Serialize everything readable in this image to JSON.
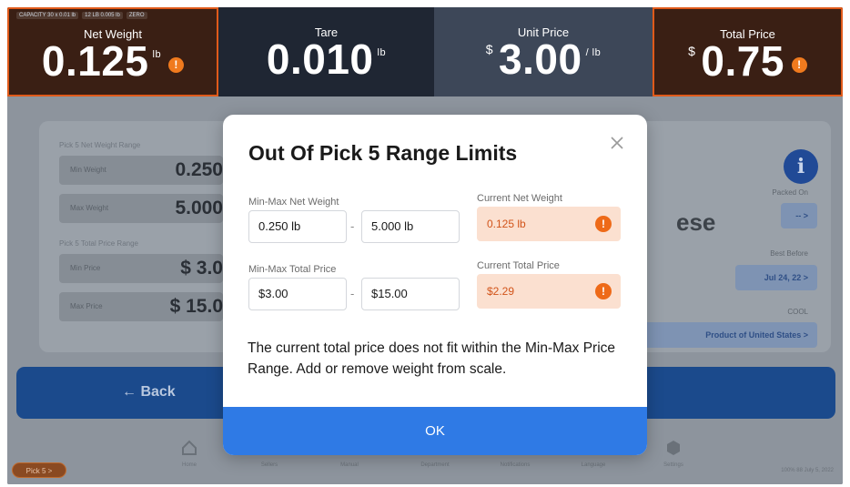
{
  "header": {
    "capacity_strip": [
      "CAPACITY 30 x 0.01 lb",
      "12 LB 0.005 lb",
      "ZERO"
    ],
    "net_weight": {
      "label": "Net Weight",
      "value": "0.125",
      "unit": "lb",
      "warning": "!"
    },
    "tare": {
      "label": "Tare",
      "value": "0.010",
      "unit": "lb"
    },
    "unit_price": {
      "label": "Unit Price",
      "currency": "$",
      "value": "3.00",
      "unit": "/ lb"
    },
    "total_price": {
      "label": "Total Price",
      "currency": "$",
      "value": "0.75",
      "warning": "!"
    }
  },
  "background": {
    "weight_range_label": "Pick 5 Net Weight Range",
    "min_weight_label": "Min Weight",
    "min_weight_value": "0.250",
    "max_weight_label": "Max Weight",
    "max_weight_value": "5.000",
    "price_range_label": "Pick 5 Total Price Range",
    "min_price_label": "Min Price",
    "min_price_value": "$ 3.0",
    "max_price_label": "Max Price",
    "max_price_value": "$ 15.0",
    "product_fragment": "ese",
    "packed_on_label": "Packed On",
    "packed_on_value": "-- >",
    "best_before_label": "Best Before",
    "best_before_value": "Jul 24, 22 >",
    "cool_label": "COOL",
    "cool_value": "Product of United States >",
    "back_label": "← Back",
    "nav": [
      "Home",
      "Sellers",
      "Manual",
      "Department",
      "Notifications",
      "Language",
      "Settings"
    ],
    "pick5_badge": "Pick 5 >",
    "status_text": "100% 88   July 5, 2022"
  },
  "modal": {
    "title": "Out Of Pick 5 Range Limits",
    "weight_range_label": "Min-Max Net Weight",
    "weight_min": "0.250 lb",
    "weight_max": "5.000 lb",
    "price_range_label": "Min-Max Total Price",
    "price_min": "$3.00",
    "price_max": "$15.00",
    "range_dash": "-",
    "current_weight_label": "Current Net Weight",
    "current_weight_value": "0.125 lb",
    "current_price_label": "Current Total Price",
    "current_price_value": "$2.29",
    "warning_glyph": "!",
    "message": "The current total price does not fit within the Min-Max Price Range. Add or remove weight from scale.",
    "ok_label": "OK"
  },
  "colors": {
    "alert_orange": "#f07a1e",
    "ok_blue": "#2f7ae5",
    "warning_bg": "#fbe0d0"
  }
}
